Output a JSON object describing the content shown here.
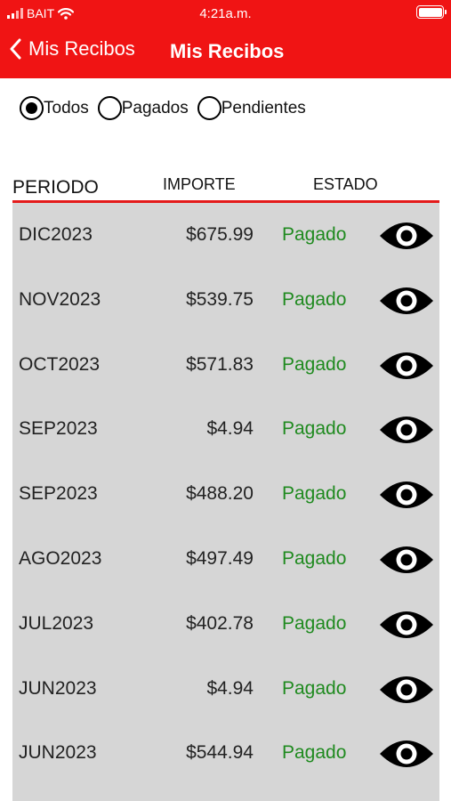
{
  "status_bar": {
    "carrier": "BAIT",
    "time": "4:21a.m."
  },
  "nav": {
    "back_label": "Mis Recibos",
    "title": "Mis Recibos"
  },
  "filters": [
    {
      "label": "Todos",
      "checked": true
    },
    {
      "label": "Pagados",
      "checked": false
    },
    {
      "label": "Pendientes",
      "checked": false
    }
  ],
  "table": {
    "columns": {
      "periodo": "PERIODO",
      "importe": "IMPORTE",
      "estado": "ESTADO"
    },
    "rows": [
      {
        "periodo": "DIC2023",
        "importe": "$675.99",
        "estado": "Pagado"
      },
      {
        "periodo": "NOV2023",
        "importe": "$539.75",
        "estado": "Pagado"
      },
      {
        "periodo": "OCT2023",
        "importe": "$571.83",
        "estado": "Pagado"
      },
      {
        "periodo": "SEP2023",
        "importe": "$4.94",
        "estado": "Pagado"
      },
      {
        "periodo": "SEP2023",
        "importe": "$488.20",
        "estado": "Pagado"
      },
      {
        "periodo": "AGO2023",
        "importe": "$497.49",
        "estado": "Pagado"
      },
      {
        "periodo": "JUL2023",
        "importe": "$402.78",
        "estado": "Pagado"
      },
      {
        "periodo": "JUN2023",
        "importe": "$4.94",
        "estado": "Pagado"
      },
      {
        "periodo": "JUN2023",
        "importe": "$544.94",
        "estado": "Pagado"
      }
    ]
  },
  "icons": {
    "back": "chevron-left-icon",
    "view": "eye-icon",
    "wifi": "wifi-icon",
    "battery": "battery-icon",
    "signal": "signal-icon"
  },
  "colors": {
    "header_bg": "#f01414",
    "paid_status": "#1f8a1f",
    "list_bg": "#d6d6d6",
    "divider": "#e41b1b"
  }
}
